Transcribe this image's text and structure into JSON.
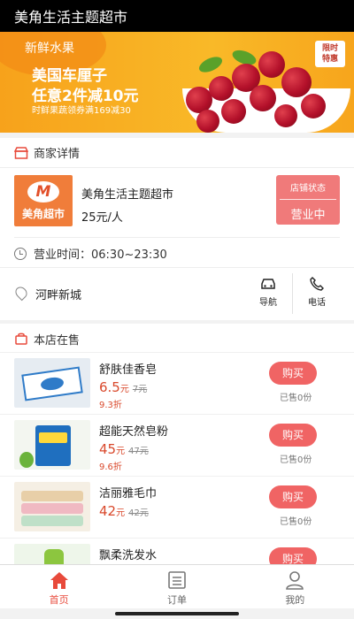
{
  "app": {
    "title": "美角生活主题超市"
  },
  "banner": {
    "fresh": "新鲜水果",
    "line1": "美国车厘子",
    "line2": "任意2件减10元",
    "sub": "时鲜果蔬领券满169减30",
    "tag_line1": "限时",
    "tag_line2": "特惠"
  },
  "shop_section": {
    "header": "商家详情"
  },
  "shop": {
    "logo_text": "美角超市",
    "name": "美角生活主题超市",
    "price": "25元/人",
    "status_label": "店铺状态",
    "status_value": "营业中",
    "hours": "营业时间：06:30~23:30",
    "address": "河畔新城",
    "nav_label": "导航",
    "phone_label": "电话"
  },
  "products_section": {
    "header": "本店在售"
  },
  "products": [
    {
      "name": "舒肤佳香皂",
      "price": "6.5",
      "unit": "元",
      "old": "7元",
      "discount": "9.3折",
      "buy": "购买",
      "sold": "已售0份"
    },
    {
      "name": "超能天然皂粉",
      "price": "45",
      "unit": "元",
      "old": "47元",
      "discount": "9.6折",
      "buy": "购买",
      "sold": "已售0份"
    },
    {
      "name": "洁丽雅毛巾",
      "price": "42",
      "unit": "元",
      "old": "42元",
      "discount": "",
      "buy": "购买",
      "sold": "已售0份"
    },
    {
      "name": "飘柔洗发水",
      "price": "",
      "unit": "",
      "old": "",
      "discount": "",
      "buy": "购买",
      "sold": ""
    }
  ],
  "tabs": [
    {
      "label": "首页",
      "icon": "home-icon",
      "active": true
    },
    {
      "label": "订单",
      "icon": "order-list-icon",
      "active": false
    },
    {
      "label": "我的",
      "icon": "user-icon",
      "active": false
    }
  ],
  "colors": {
    "accent": "#e84a3b",
    "buy": "#f06464",
    "banner": "#f9b928",
    "logo": "#f07d3a"
  }
}
